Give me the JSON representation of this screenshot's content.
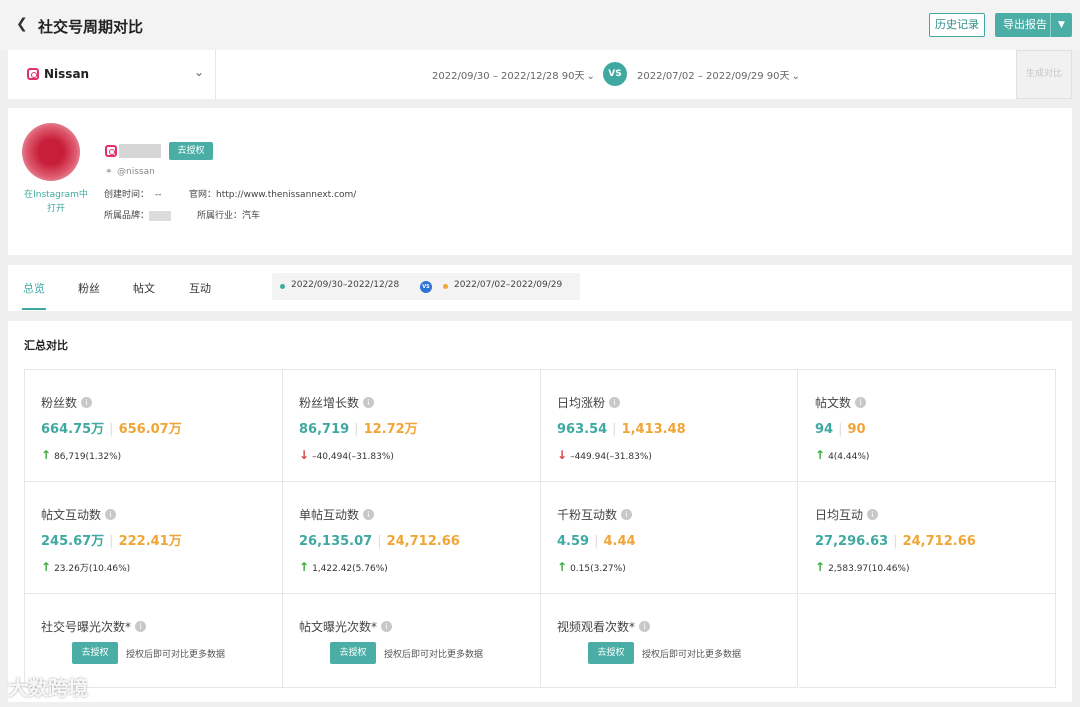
{
  "header": {
    "back_icon": "chevron-left-icon",
    "title": "社交号周期对比",
    "history_button": "历史记录",
    "export_button": "导出报告"
  },
  "selector": {
    "brand": "Nissan",
    "period_a": "2022/09/30 – 2022/12/28 90天",
    "vs_label": "VS",
    "period_b": "2022/07/02 – 2022/09/29 90天",
    "generate_button": "生成对比"
  },
  "profile": {
    "open_in": "在Instagram中打开",
    "authorize_button": "去授权",
    "handle": "@nissan",
    "created_label": "创建时间：",
    "created_value": "--",
    "website_label": "官网：",
    "website_value": "http://www.thenissannext.com/",
    "brand_label": "所属品牌：",
    "industry_label": "所属行业：",
    "industry_value": "汽车"
  },
  "tabs": [
    "总览",
    "粉丝",
    "帖文",
    "互动"
  ],
  "legend": {
    "period_a": "2022/09/30–2022/12/28",
    "vs": "VS",
    "period_b": "2022/07/02–2022/09/29"
  },
  "summary": {
    "title": "汇总对比",
    "metrics": [
      {
        "label": "粉丝数",
        "a": "664.75万",
        "b": "656.07万",
        "dir": "up",
        "change": "86,719(1.32%)"
      },
      {
        "label": "粉丝增长数",
        "a": "86,719",
        "b": "12.72万",
        "dir": "down",
        "change": "–40,494(–31.83%)"
      },
      {
        "label": "日均涨粉",
        "a": "963.54",
        "b": "1,413.48",
        "dir": "down",
        "change": "–449.94(–31.83%)"
      },
      {
        "label": "帖文数",
        "a": "94",
        "b": "90",
        "dir": "up",
        "change": "4(4.44%)"
      },
      {
        "label": "帖文互动数",
        "a": "245.67万",
        "b": "222.41万",
        "dir": "up",
        "change": "23.26万(10.46%)"
      },
      {
        "label": "单帖互动数",
        "a": "26,135.07",
        "b": "24,712.66",
        "dir": "up",
        "change": "1,422.42(5.76%)"
      },
      {
        "label": "千粉互动数",
        "a": "4.59",
        "b": "4.44",
        "dir": "up",
        "change": "0.15(3.27%)"
      },
      {
        "label": "日均互动",
        "a": "27,296.63",
        "b": "24,712.66",
        "dir": "up",
        "change": "2,583.97(10.46%)"
      }
    ],
    "locked": [
      {
        "label": "社交号曝光次数*",
        "button": "去授权",
        "hint": "授权后即可对比更多数据"
      },
      {
        "label": "帖文曝光次数*",
        "button": "去授权",
        "hint": "授权后即可对比更多数据"
      },
      {
        "label": "视频观看次数*",
        "button": "去授权",
        "hint": "授权后即可对比更多数据"
      }
    ]
  },
  "colors": {
    "period_a": "#3fa9a1",
    "period_b": "#f0a534",
    "up": "#3aab3a",
    "down": "#d64545"
  },
  "watermark": "大数跨境"
}
